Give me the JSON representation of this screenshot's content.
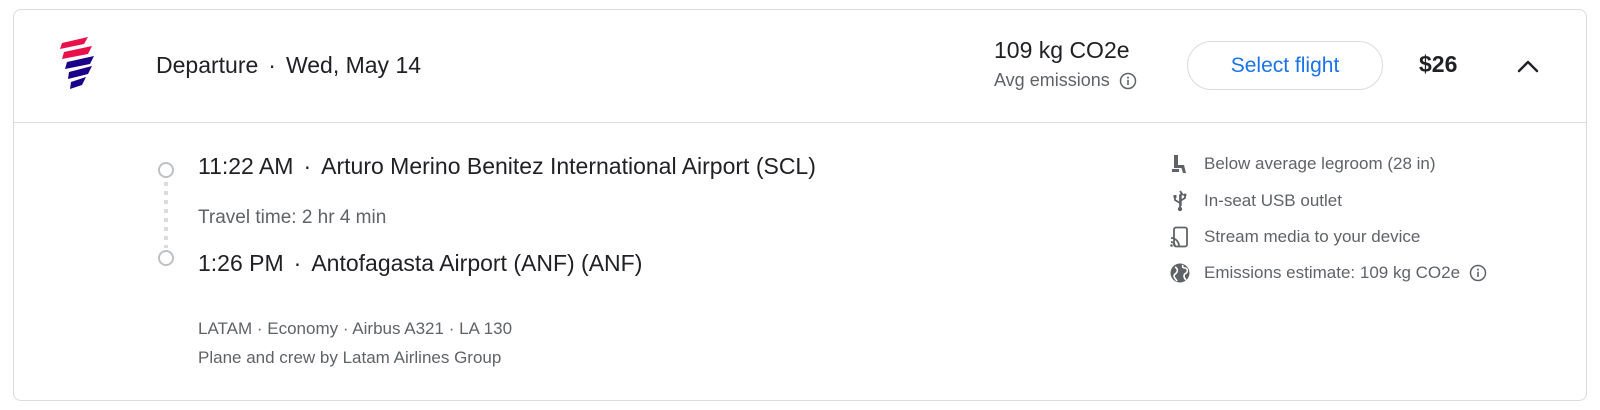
{
  "header": {
    "direction": "Departure",
    "separator": "·",
    "date": "Wed, May 14",
    "emissions_value": "109 kg CO2e",
    "emissions_label": "Avg emissions",
    "select_label": "Select flight",
    "price": "$26"
  },
  "segment": {
    "departure": {
      "time": "11:22 AM",
      "airport": "Arturo Merino Benitez International Airport (SCL)"
    },
    "travel_time": "Travel time: 2 hr 4 min",
    "arrival": {
      "time": "1:26 PM",
      "airport": "Antofagasta Airport (ANF) (ANF)"
    },
    "flight_info": "LATAM · Economy · Airbus A321 · LA 130",
    "operator": "Plane and crew by Latam Airlines Group"
  },
  "amenities": [
    {
      "icon": "legroom-icon",
      "text": "Below average legroom (28 in)"
    },
    {
      "icon": "usb-icon",
      "text": "In-seat USB outlet"
    },
    {
      "icon": "stream-media-icon",
      "text": "Stream media to your device"
    },
    {
      "icon": "globe-icon",
      "text": "Emissions estimate: 109 kg CO2e"
    }
  ],
  "colors": {
    "accent": "#1a73e8",
    "border": "#dadce0",
    "secondary_text": "#5f6368",
    "logo_red": "#e8114b",
    "logo_blue": "#1b0088"
  }
}
